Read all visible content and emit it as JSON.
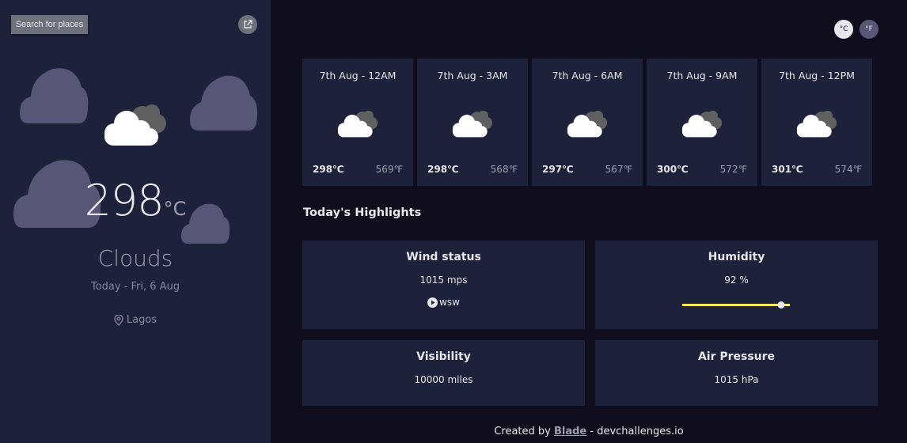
{
  "sidebar": {
    "search_label": "Search for places",
    "location_button_icon": "external-link-icon",
    "weather_icon": "cloud-icon",
    "temperature": "298",
    "temperature_unit": "°C",
    "description": "Clouds",
    "date": "Today - Fri, 6 Aug",
    "location": "Lagos",
    "location_icon": "map-pin-icon"
  },
  "units": {
    "celsius": "°C",
    "fahrenheit": "°F",
    "selected": "°C"
  },
  "forecast": [
    {
      "date": "7th Aug - 12AM",
      "max": "298℃",
      "min": "569℉",
      "icon": "cloud-icon"
    },
    {
      "date": "7th Aug - 3AM",
      "max": "298℃",
      "min": "568℉",
      "icon": "cloud-icon"
    },
    {
      "date": "7th Aug - 6AM",
      "max": "297℃",
      "min": "567℉",
      "icon": "cloud-icon"
    },
    {
      "date": "7th Aug - 9AM",
      "max": "300℃",
      "min": "572℉",
      "icon": "cloud-icon"
    },
    {
      "date": "7th Aug - 12PM",
      "max": "301℃",
      "min": "574℉",
      "icon": "cloud-icon"
    }
  ],
  "highlights": {
    "title": "Today's Highlights",
    "wind": {
      "title": "Wind status",
      "value": "1015 mps",
      "direction": "wsw",
      "icon": "compass-icon"
    },
    "humidity": {
      "title": "Humidity",
      "value": "92 %",
      "percent": 92
    },
    "visibility": {
      "title": "Visibility",
      "value": "10000 miles"
    },
    "pressure": {
      "title": "Air Pressure",
      "value": "1015 hPa"
    }
  },
  "footer": {
    "prefix": "Created by ",
    "author": "Blade",
    "suffix": " - devchallenges.io"
  },
  "colors": {
    "background": "#100e1d",
    "panel": "#1e213a",
    "bg_cloud": "#585676",
    "slider": "#ffec65"
  }
}
